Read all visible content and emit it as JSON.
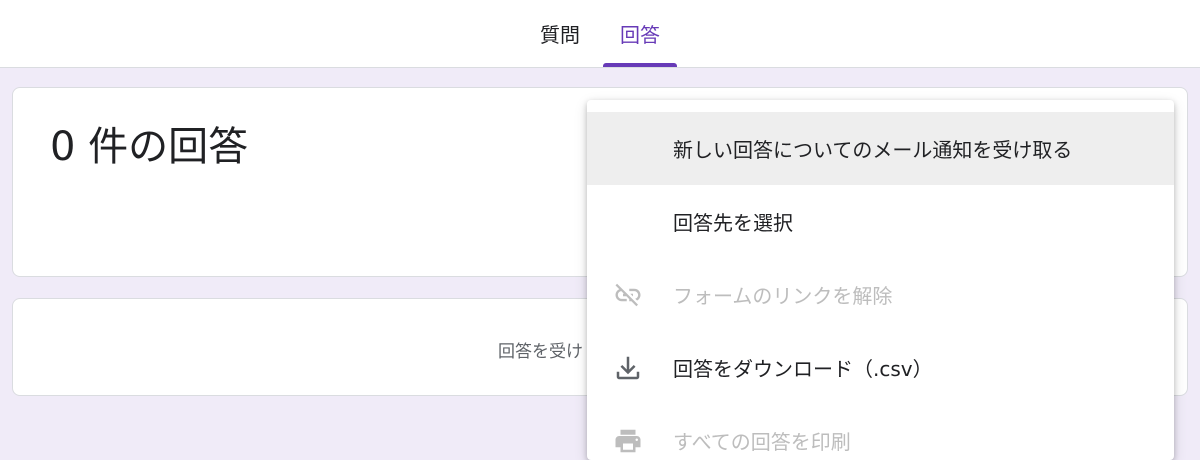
{
  "tabs": {
    "questions": "質問",
    "responses": "回答"
  },
  "summary": {
    "count_title": "0 件の回答"
  },
  "accepting": {
    "text": "回答を受け"
  },
  "menu": {
    "items": [
      {
        "label": "新しい回答についてのメール通知を受け取る",
        "icon": "",
        "disabled": false
      },
      {
        "label": "回答先を選択",
        "icon": "",
        "disabled": false
      },
      {
        "label": "フォームのリンクを解除",
        "icon": "unlink-icon",
        "disabled": true
      },
      {
        "label": "回答をダウンロード（.csv）",
        "icon": "download-icon",
        "disabled": false
      },
      {
        "label": "すべての回答を印刷",
        "icon": "print-icon",
        "disabled": true
      }
    ]
  },
  "colors": {
    "accent": "#673ab7",
    "page_background": "#f0ebf8",
    "highlight": "#eeeeee",
    "disabled_text": "#bdbdbd"
  }
}
